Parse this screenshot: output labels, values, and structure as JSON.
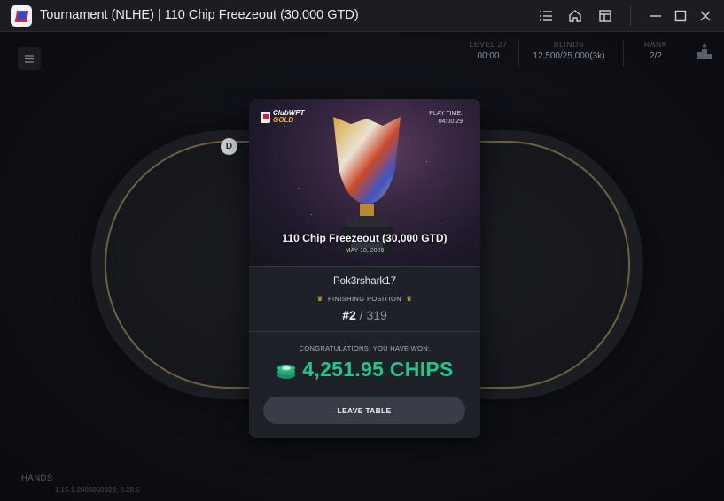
{
  "window": {
    "title": "Tournament (NLHE) | 110 Chip Freezeout (30,000 GTD)",
    "icons": [
      "list-icon",
      "home-icon",
      "layout-icon",
      "minimize-icon",
      "maximize-icon",
      "close-icon"
    ]
  },
  "hud": {
    "level": {
      "label": "LEVEL 27",
      "value": "00:00"
    },
    "blinds": {
      "label": "BLINDS",
      "value": "12,500/25,000(3k)"
    },
    "rank": {
      "label": "RANK",
      "value": "2/2"
    }
  },
  "table": {
    "dealer_button": "D"
  },
  "footer": {
    "hands_label": "HANDS",
    "version": "1.15.1.2605060929, 3.28.6"
  },
  "result_modal": {
    "brand_line1": "ClubWPT",
    "brand_line2": "GOLD",
    "play_time_label": "PLAY TIME:",
    "play_time_value": "04:00:29",
    "event_name": "110 Chip Freezeout (30,000 GTD)",
    "event_date": "MAY 10, 2026",
    "player_name": "Pok3rshark17",
    "finishing_label": "FINISHING POSITION",
    "finish_place": "#2",
    "finish_separator": "/",
    "total_entrants": "319",
    "congrats_text": "CONGRATULATIONS! YOU HAVE WON:",
    "prize_amount": "4,251.95 CHIPS",
    "leave_button": "LEAVE TABLE"
  },
  "colors": {
    "accent_green": "#24c58a",
    "gold": "#e8b62a",
    "brand_red": "#d11f39"
  }
}
